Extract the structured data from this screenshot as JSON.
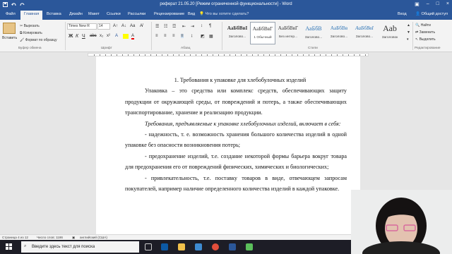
{
  "app": {
    "title": "реферат 21.05.20 [Режим ограниченной функциональности] - Word",
    "tabs": [
      "Файл",
      "Главная",
      "Вставка",
      "Дизайн",
      "Макет",
      "Ссылки",
      "Рассылки",
      "Рецензирование",
      "Вид"
    ],
    "active_tab": "Главная",
    "tell_me": "Что вы хотите сделать?",
    "login": "Вход",
    "share": "Общий доступ",
    "colors": {
      "brand": "#2b579a",
      "ribbon": "#f3f3f3",
      "taskbar": "#1d1d26"
    }
  },
  "ribbon": {
    "clipboard": {
      "paste": "Вставить",
      "cut": "Вырезать",
      "copy": "Копировать",
      "format_painter": "Формат по образцу",
      "label": "Буфер обмена"
    },
    "font": {
      "name": "Times New R",
      "size": "14",
      "label": "Шрифт"
    },
    "paragraph": {
      "label": "Абзац"
    },
    "styles": {
      "label": "Стили",
      "items": [
        {
          "sample": "АаБбВвІ",
          "name": "Заголово..."
        },
        {
          "sample": "АаБбВвГ",
          "name": "1 Обычный"
        },
        {
          "sample": "АаБбВвГ",
          "name": "Без интер..."
        },
        {
          "sample": "АаБбВ",
          "name": "Заголово..."
        },
        {
          "sample": "АаБбВв",
          "name": "Заголово..."
        },
        {
          "sample": "АаБбВвІ",
          "name": "Заголово..."
        },
        {
          "sample": "Ааb",
          "name": "Заголовок"
        }
      ]
    },
    "editing": {
      "find": "Найти",
      "replace": "Заменить",
      "select": "Выделить",
      "label": "Редактирование"
    }
  },
  "document": {
    "heading": "1.          Требования к упаковке для хлебобулочных изделий",
    "paragraphs": [
      "Упаковка – это средства или комплекс средств, обеспечивающих защиту продукции от окружающей среды, от повреждений и потерь, а также обеспечивающих транспортирование, хранение и реализацию продукции.",
      "Требования, предъявляемые к упаковке хлебобулочных изделий, включает в себя:",
      "- надежность, т. е. возможность хранения большого количества изделий в одной упаковке без опасности возникновения потерь;",
      "- предохранение изделий, т.е. создание некоторой формы барьера вокруг товара для предохранения его от повреждений физических, химических и биологических;",
      "- привлекательность, т.е. поставку товаров в виде, отвечающем запросам покупателей, например наличие определенного количества изделий в каждой упаковке."
    ]
  },
  "status": {
    "page": "Страница 4 из 12",
    "words": "Число слов: 1186",
    "language": "английский (США)",
    "zoom": "100%"
  },
  "taskbar": {
    "search_placeholder": "Введите здесь текст для поиска"
  }
}
